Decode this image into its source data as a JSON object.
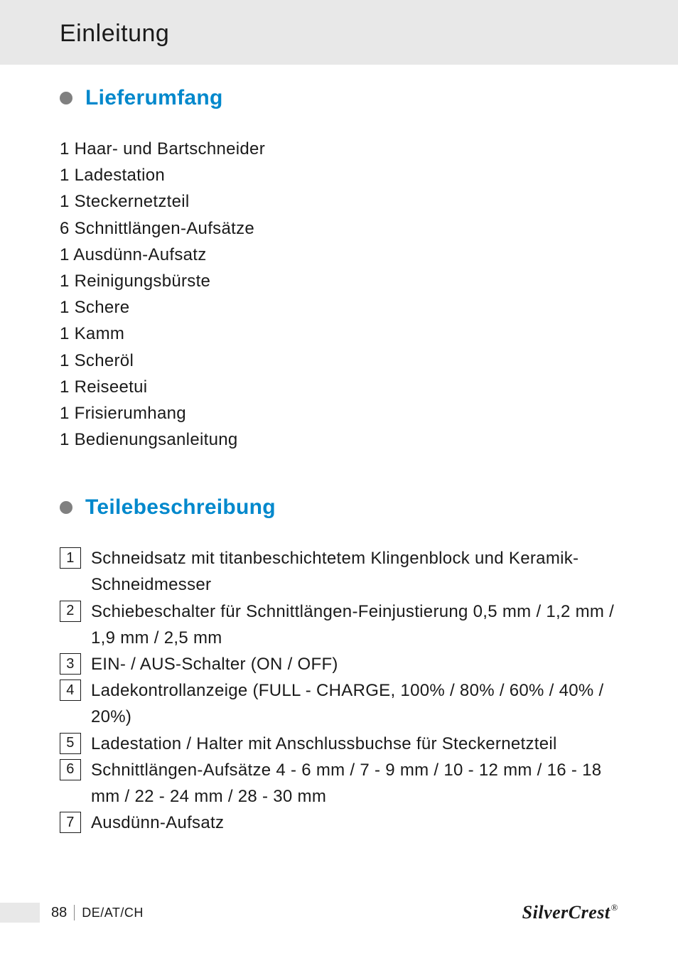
{
  "header": {
    "title": "Einleitung"
  },
  "sections": {
    "delivery": {
      "title": "Lieferumfang",
      "items": [
        "1 Haar- und Bartschneider",
        "1 Ladestation",
        "1 Steckernetzteil",
        "6 Schnittlängen-Aufsätze",
        "1 Ausdünn-Aufsatz",
        "1 Reinigungsbürste",
        "1 Schere",
        "1 Kamm",
        "1 Scheröl",
        "1 Reiseetui",
        "1 Frisierumhang",
        "1 Bedienungsanleitung"
      ]
    },
    "parts": {
      "title": "Teilebeschreibung",
      "items": [
        {
          "num": "1",
          "text": "Schneidsatz mit titanbeschichtetem Klingenblock und Keramik-Schneidmesser"
        },
        {
          "num": "2",
          "text": "Schiebeschalter für Schnittlängen-Feinjustierung 0,5 mm / 1,2 mm / 1,9 mm / 2,5 mm"
        },
        {
          "num": "3",
          "text": "EIN- / AUS-Schalter (ON / OFF)"
        },
        {
          "num": "4",
          "text": "Ladekontrollanzeige (FULL - CHARGE, 100% / 80% / 60% / 40% / 20%)"
        },
        {
          "num": "5",
          "text": "Ladestation / Halter mit Anschlussbuchse für Steckernetzteil"
        },
        {
          "num": "6",
          "text": "Schnittlängen-Aufsätze 4 - 6 mm / 7 - 9 mm / 10 - 12 mm / 16 - 18 mm / 22 - 24 mm / 28 - 30 mm"
        },
        {
          "num": "7",
          "text": "Ausdünn-Aufsatz"
        }
      ]
    }
  },
  "footer": {
    "page": "88",
    "region": "DE/AT/CH",
    "brand_main": "SilverCrest",
    "brand_reg": "®"
  }
}
